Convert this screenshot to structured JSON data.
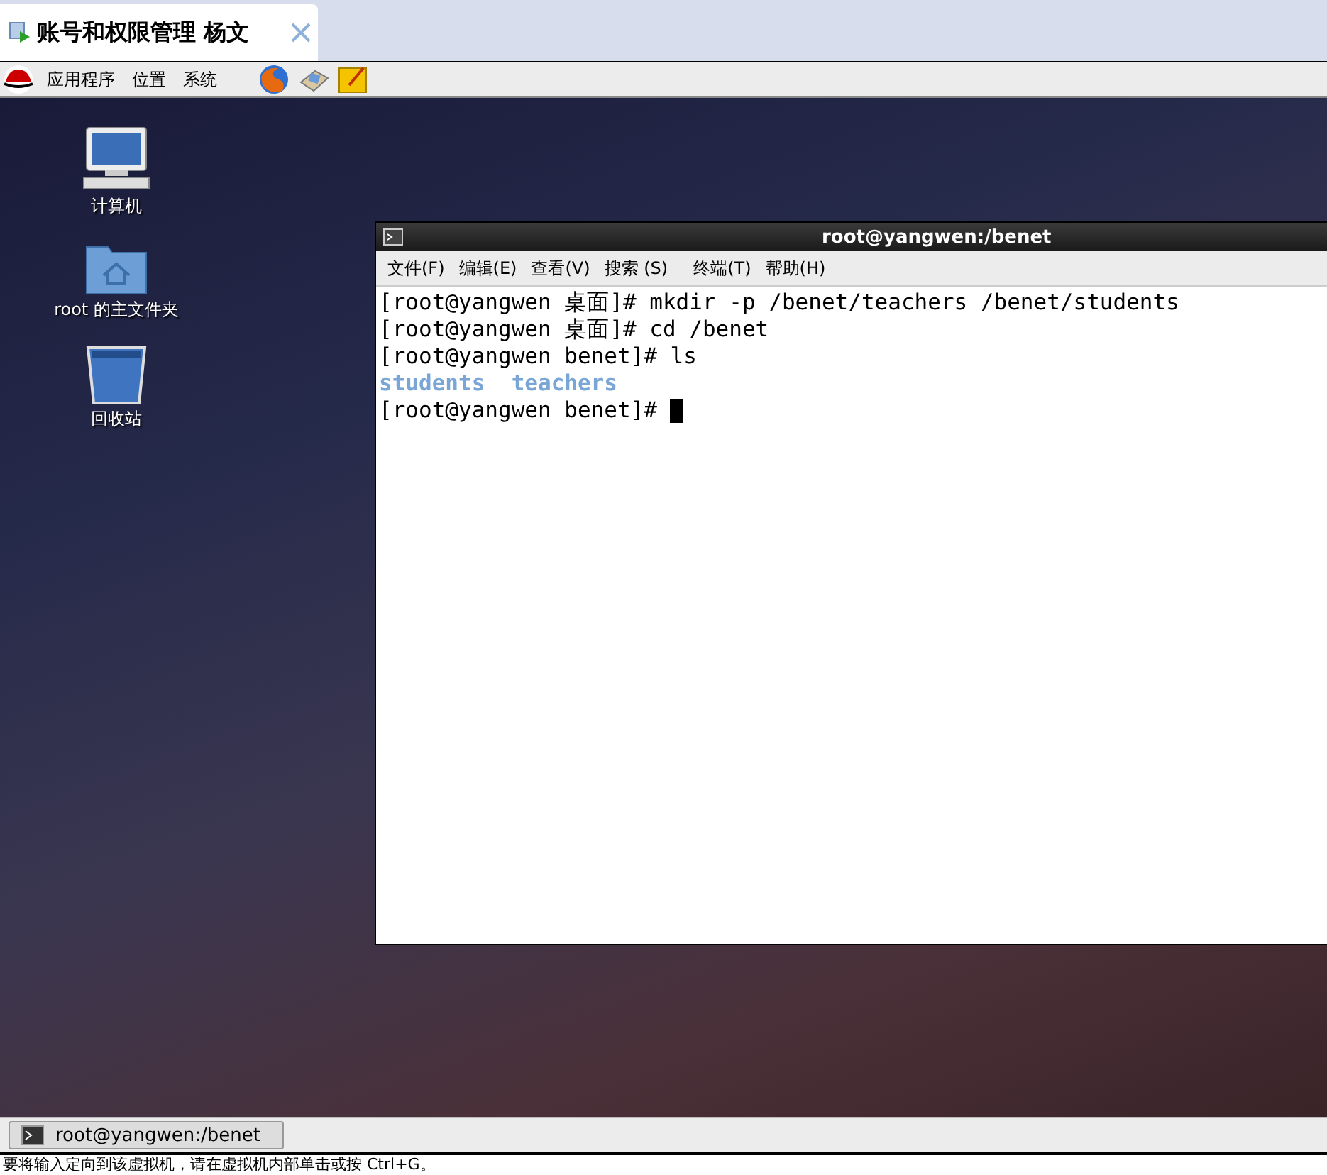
{
  "tab": {
    "title": "账号和权限管理 杨文"
  },
  "top_panel": {
    "menus": [
      "应用程序",
      "位置",
      "系统"
    ]
  },
  "desktop_icons": [
    {
      "kind": "computer",
      "label": "计算机"
    },
    {
      "kind": "home",
      "label": "root 的主文件夹"
    },
    {
      "kind": "trash",
      "label": "回收站"
    }
  ],
  "terminal": {
    "title": "root@yangwen:/benet",
    "menus": [
      "文件(F)",
      "编辑(E)",
      "查看(V)",
      "搜索 (S)",
      "终端(T)",
      "帮助(H)"
    ],
    "lines": [
      {
        "kind": "command",
        "text": "[root@yangwen 桌面]# mkdir -p /benet/teachers /benet/students"
      },
      {
        "kind": "command",
        "text": "[root@yangwen 桌面]# cd /benet"
      },
      {
        "kind": "command",
        "text": "[root@yangwen benet]# ls"
      },
      {
        "kind": "directory",
        "text": "students  teachers"
      },
      {
        "kind": "prompt",
        "text": "[root@yangwen benet]# "
      }
    ]
  },
  "taskbar": {
    "items": [
      {
        "label": "root@yangwen:/benet",
        "selected": false
      }
    ]
  },
  "status_bar": {
    "text": "要将输入定向到该虚拟机，请在虚拟机内部单击或按 Ctrl+G。"
  }
}
